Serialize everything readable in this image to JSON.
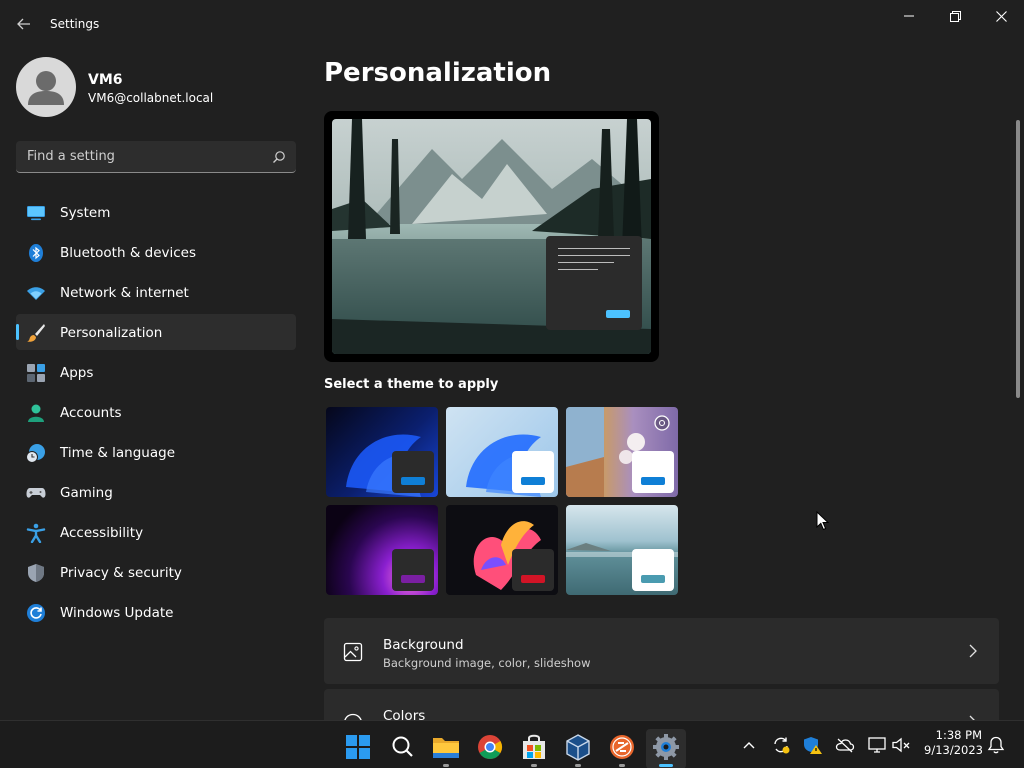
{
  "window": {
    "title": "Settings"
  },
  "user": {
    "name": "VM6",
    "email": "VM6@collabnet.local"
  },
  "search": {
    "placeholder": "Find a setting"
  },
  "sidebar": {
    "items": [
      {
        "label": "System",
        "icon": "system-icon"
      },
      {
        "label": "Bluetooth & devices",
        "icon": "bluetooth-icon"
      },
      {
        "label": "Network & internet",
        "icon": "wifi-icon"
      },
      {
        "label": "Personalization",
        "icon": "paintbrush-icon",
        "selected": true
      },
      {
        "label": "Apps",
        "icon": "apps-icon"
      },
      {
        "label": "Accounts",
        "icon": "person-icon"
      },
      {
        "label": "Time & language",
        "icon": "globe-clock-icon"
      },
      {
        "label": "Gaming",
        "icon": "gamepad-icon"
      },
      {
        "label": "Accessibility",
        "icon": "accessibility-icon"
      },
      {
        "label": "Privacy & security",
        "icon": "shield-icon"
      },
      {
        "label": "Windows Update",
        "icon": "refresh-icon"
      }
    ]
  },
  "main": {
    "title": "Personalization",
    "themes_label": "Select a theme to apply",
    "themes": [
      {
        "id": "windows-dark",
        "accent": "#0f7fd6"
      },
      {
        "id": "windows-light",
        "accent": "#0f7fd6"
      },
      {
        "id": "windows-spotlight",
        "accent": "#0f7fd6"
      },
      {
        "id": "glow",
        "accent": "#7a1fa2"
      },
      {
        "id": "captured-motion",
        "accent": "#d21426"
      },
      {
        "id": "flow",
        "accent": "#4a9bb0"
      }
    ],
    "settings": [
      {
        "title": "Background",
        "subtitle": "Background image, color, slideshow",
        "icon": "image-icon"
      },
      {
        "title": "Colors",
        "subtitle": "",
        "icon": "palette-icon"
      }
    ]
  },
  "taskbar": {
    "time": "1:38 PM",
    "date": "9/13/2023"
  },
  "colors": {
    "accent": "#4cc2ff",
    "background": "#202020",
    "card": "#2b2b2b"
  }
}
